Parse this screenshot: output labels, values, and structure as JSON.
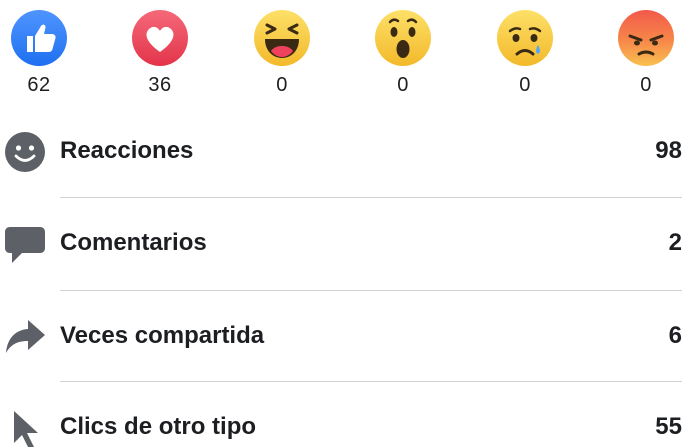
{
  "reactions": [
    {
      "name": "like",
      "count": "62",
      "color": "#3b82f6"
    },
    {
      "name": "love",
      "count": "36",
      "color": "#ef4d5d"
    },
    {
      "name": "haha",
      "count": "0",
      "color": "#f7c844"
    },
    {
      "name": "wow",
      "count": "0",
      "color": "#f7c844"
    },
    {
      "name": "sad",
      "count": "0",
      "color": "#f7c844"
    },
    {
      "name": "angry",
      "count": "0",
      "color": "#f0663c"
    }
  ],
  "stats": [
    {
      "label": "Reacciones",
      "value": "98",
      "icon": "smiley-icon"
    },
    {
      "label": "Comentarios",
      "value": "2",
      "icon": "comment-icon"
    },
    {
      "label": "Veces compartida",
      "value": "6",
      "icon": "share-arrow-icon"
    },
    {
      "label": "Clics de otro tipo",
      "value": "55",
      "icon": "cursor-icon"
    }
  ],
  "colors": {
    "icon_gray": "#5d6066",
    "divider": "#d0d2d6",
    "text": "#1c1e21"
  }
}
